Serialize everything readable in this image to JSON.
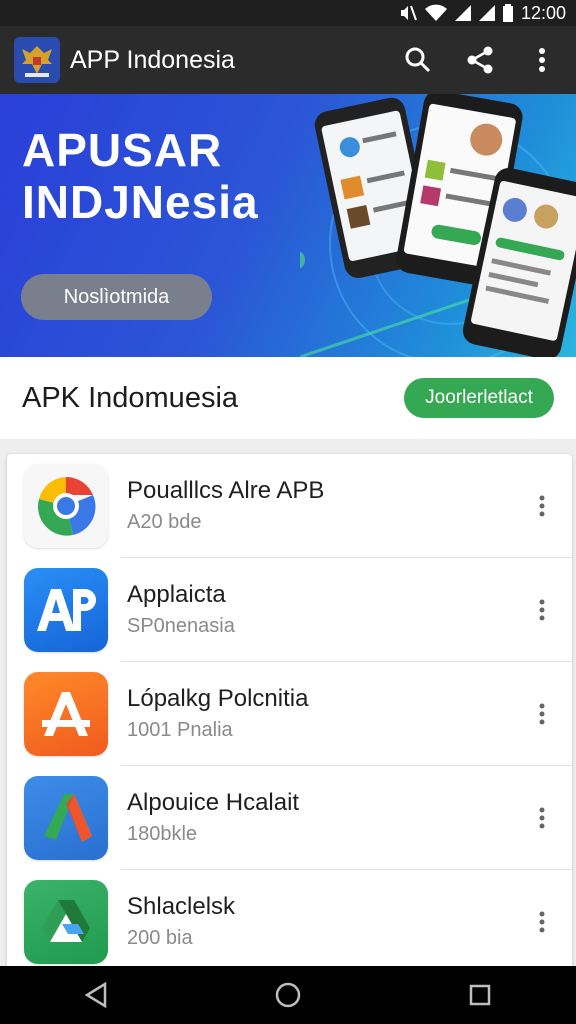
{
  "status_bar": {
    "time": "12:00",
    "icons": [
      "mute-icon",
      "wifi-icon",
      "signal-icon",
      "signal-icon",
      "battery-icon"
    ]
  },
  "app_bar": {
    "title": "APP Indonesia",
    "logo_icon": "garuda-emblem-icon",
    "actions": [
      "search-icon",
      "share-icon",
      "more-vert-icon"
    ]
  },
  "banner": {
    "title_line1": "APUSAR",
    "title_line2": "INDJNesia",
    "button_label": "Noslìotmida"
  },
  "header": {
    "title": "APK Indomuesia",
    "download_label": "Joorlerletlact"
  },
  "apps": [
    {
      "name": "Poualllcs Alre APB",
      "sub": "A20 bde",
      "icon": "chrome-like-icon"
    },
    {
      "name": "Applaicta",
      "sub": "SP0nenasia",
      "icon": "ap-letter-icon"
    },
    {
      "name": "Lópalkg Polcnitia",
      "sub": "1001 Pnalia",
      "icon": "a-letter-icon"
    },
    {
      "name": "Alpouice Hcalait",
      "sub": "180bkle",
      "icon": "ads-triangle-icon"
    },
    {
      "name": "Shlaclelsk",
      "sub": "200 bia",
      "icon": "drive-like-icon"
    }
  ],
  "colors": {
    "app_bar": "#2b2b2b",
    "accent_green": "#34a853",
    "banner_blue": "#2b56d6"
  }
}
